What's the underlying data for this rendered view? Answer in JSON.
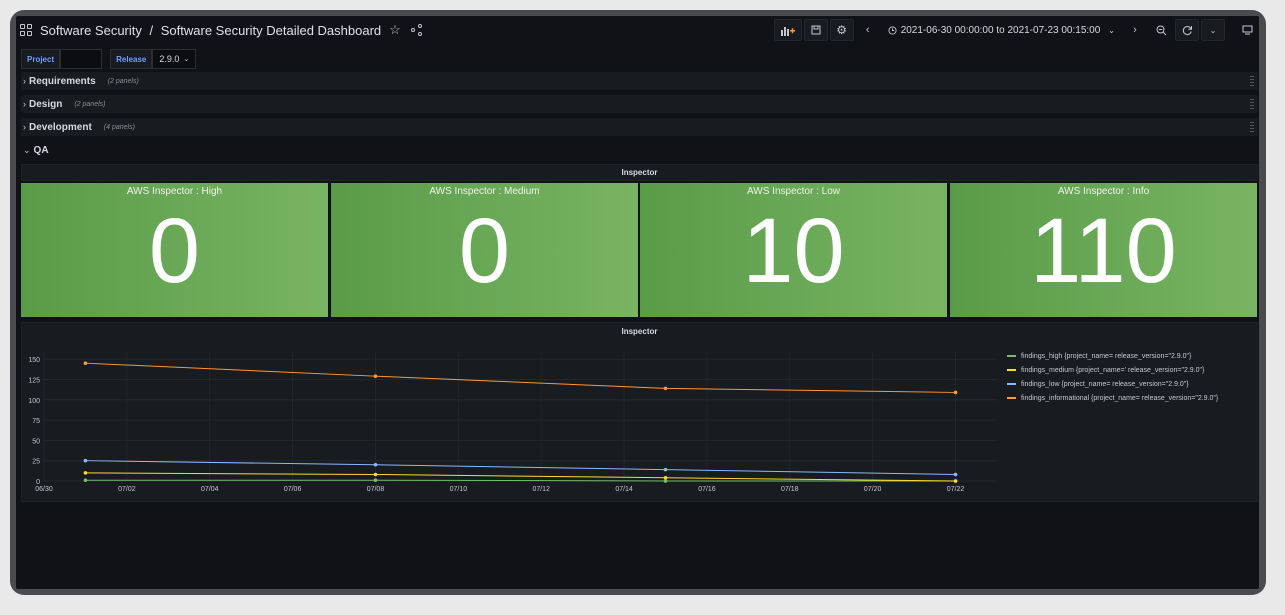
{
  "header": {
    "folder": "Software Security",
    "separator": "/",
    "dashboard": "Software Security Detailed Dashboard",
    "time_range": "2021-06-30 00:00:00 to 2021-07-23 00:15:00"
  },
  "variables": {
    "project_label": "Project",
    "project_value": "",
    "release_label": "Release",
    "release_value": "2.9.0"
  },
  "rows": [
    {
      "name": "Requirements",
      "count": "(2 panels)"
    },
    {
      "name": "Design",
      "count": "(2 panels)"
    },
    {
      "name": "Development",
      "count": "(4 panels)"
    }
  ],
  "qa_row": {
    "name": "QA"
  },
  "stat_group_title": "Inspector",
  "stats": [
    {
      "label": "AWS Inspector : High",
      "value": "0"
    },
    {
      "label": "AWS Inspector : Medium",
      "value": "0"
    },
    {
      "label": "AWS Inspector : Low",
      "value": "10"
    },
    {
      "label": "AWS Inspector : Info",
      "value": "110"
    }
  ],
  "colors": {
    "high": "#73bf69",
    "medium": "#fade2a",
    "low": "#8ab8ff",
    "informational": "#ff9830"
  },
  "chart_data": {
    "type": "line",
    "title": "Inspector",
    "x_ticks": [
      "06/30",
      "07/02",
      "07/04",
      "07/06",
      "07/08",
      "07/10",
      "07/12",
      "07/14",
      "07/16",
      "07/18",
      "07/20",
      "07/22"
    ],
    "y_ticks": [
      "0",
      "25",
      "50",
      "75",
      "100",
      "125",
      "150"
    ],
    "ylim": [
      0,
      160
    ],
    "x": [
      "2021-07-01",
      "2021-07-08",
      "2021-07-15",
      "2021-07-22"
    ],
    "series": [
      {
        "name": "findings_high {project_name=  release_version=\"2.9.0\"}",
        "color": "#73bf69",
        "values": [
          1,
          1,
          0,
          0
        ]
      },
      {
        "name": "findings_medium {project_name='  release_version=\"2.9.0\"}",
        "color": "#fade2a",
        "values": [
          10,
          8,
          4,
          0
        ]
      },
      {
        "name": "findings_low {project_name=  release_version=\"2.9.0\"}",
        "color": "#8ab8ff",
        "values": [
          25,
          20,
          14,
          8
        ]
      },
      {
        "name": "findings_informational {project_name= release_version=\"2.9.0\"}",
        "color": "#ff9830",
        "values": [
          145,
          129,
          114,
          109
        ]
      }
    ],
    "grid": true,
    "legend": "right"
  }
}
